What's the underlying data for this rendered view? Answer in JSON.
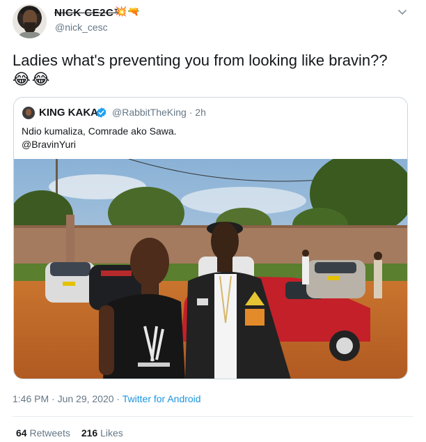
{
  "tweet": {
    "display_name": "NICK CE2C™",
    "name_emojis": "💥🔫",
    "handle": "@nick_cesc",
    "text": "Ladies what's preventing you from looking like bravin??",
    "text_emojis": "😂😂",
    "timestamp": "1:46 PM · Jun 29, 2020",
    "separator": " · ",
    "source": "Twitter for Android",
    "retweets": "64",
    "retweets_label": "Retweets",
    "likes": "216",
    "likes_label": "Likes"
  },
  "quoted": {
    "display_name": "KING KAKA",
    "handle": "@RabbitTheKing",
    "separator": "·",
    "time": "2h",
    "text_line1": "Ndio kumaliza, Comrade ako Sawa.",
    "text_line2": "@BravinYuri"
  },
  "icons": {
    "menu": "chevron-down-icon",
    "verified": "verified-badge-icon"
  },
  "colors": {
    "link": "#1b95e0",
    "secondary_text": "#657786",
    "verified": "#1da1f2"
  }
}
